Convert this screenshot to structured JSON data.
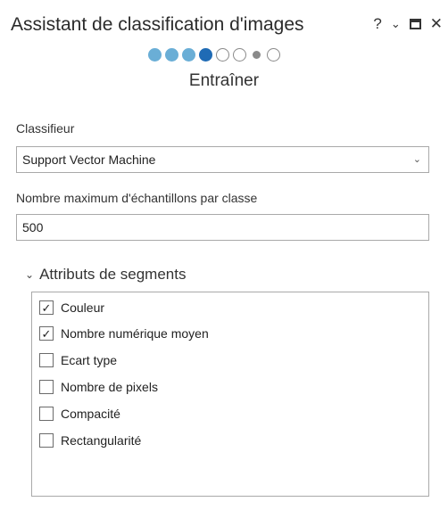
{
  "panel": {
    "title": "Assistant de classification d'images",
    "help_glyph": "?",
    "collapse_glyph": "⌄",
    "close_glyph": "✕"
  },
  "wizard": {
    "steps": [
      {
        "state": "done"
      },
      {
        "state": "done"
      },
      {
        "state": "done"
      },
      {
        "state": "current"
      },
      {
        "state": "todo"
      },
      {
        "state": "todo"
      },
      {
        "state": "small"
      },
      {
        "state": "todo"
      }
    ],
    "current_step_label": "Entraîner"
  },
  "classifier": {
    "label": "Classifieur",
    "value": "Support Vector Machine",
    "arrow_glyph": "⌄"
  },
  "max_samples": {
    "label": "Nombre maximum d'échantillons par classe",
    "value": "500"
  },
  "segment_attributes": {
    "title": "Attributs de segments",
    "chevron_glyph": "⌄",
    "check_glyph": "✓",
    "items": [
      {
        "label": "Couleur",
        "checked": true
      },
      {
        "label": "Nombre numérique moyen",
        "checked": true
      },
      {
        "label": "Ecart type",
        "checked": false
      },
      {
        "label": "Nombre de pixels",
        "checked": false
      },
      {
        "label": "Compacité",
        "checked": false
      },
      {
        "label": "Rectangularité",
        "checked": false
      }
    ]
  },
  "colors": {
    "step_done": "#6aaed6",
    "step_current": "#1f6bb5",
    "border": "#a9a9a9"
  }
}
